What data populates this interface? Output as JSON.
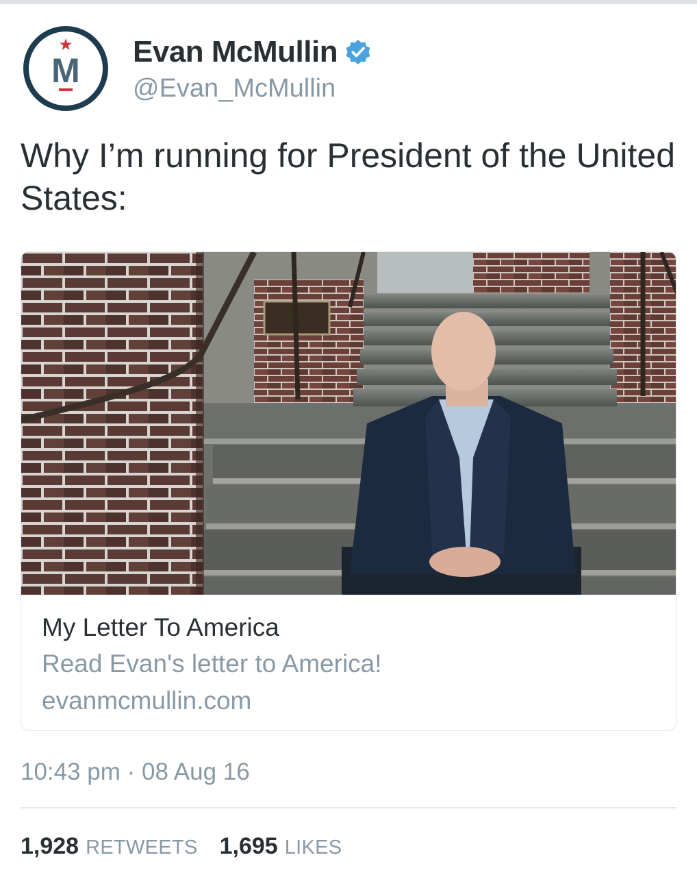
{
  "profile": {
    "display_name": "Evan McMullin",
    "handle": "@Evan_McMullin",
    "avatar_letter": "M",
    "verified_icon": "verified-badge-icon"
  },
  "tweet": {
    "text": "Why I’m running for President of the United States:"
  },
  "card": {
    "title": "My Letter To America",
    "description": "Read Evan's letter to America!",
    "domain": "evanmcmullin.com"
  },
  "meta": {
    "timestamp": "10:43 pm · 08 Aug 16"
  },
  "stats": {
    "retweets_count": "1,928",
    "retweets_label": "RETWEETS",
    "likes_count": "1,695",
    "likes_label": "LIKES"
  },
  "colors": {
    "text": "#292f33",
    "secondary": "#8899a6",
    "verified_blue": "#4aa3df",
    "avatar_navy": "#1e3c50",
    "avatar_red": "#d0343a"
  }
}
